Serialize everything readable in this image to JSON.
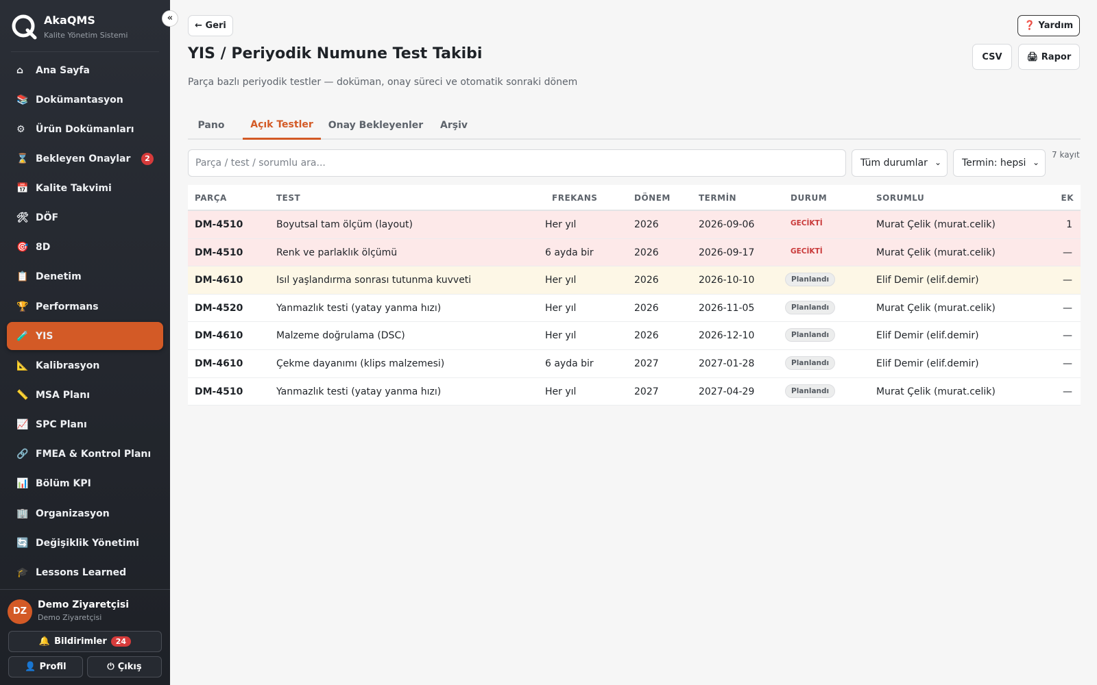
{
  "app": {
    "name": "AkaQMS",
    "subtitle": "Kalite Yönetim Sistemi",
    "collapse": "«"
  },
  "sidebar": {
    "items": [
      {
        "icon": "⌂",
        "label": "Ana Sayfa"
      },
      {
        "icon": "📚",
        "label": "Dokümantasyon"
      },
      {
        "icon": "⚙",
        "label": "Ürün Dokümanları"
      },
      {
        "icon": "⌛",
        "label": "Bekleyen Onaylar",
        "badge": "2"
      },
      {
        "icon": "📅",
        "label": "Kalite Takvimi"
      },
      {
        "icon": "🛠",
        "label": "DÖF"
      },
      {
        "icon": "🎯",
        "label": "8D"
      },
      {
        "icon": "📋",
        "label": "Denetim"
      },
      {
        "icon": "🏆",
        "label": "Performans"
      },
      {
        "icon": "🧪",
        "label": "YIS",
        "active": true
      },
      {
        "icon": "📐",
        "label": "Kalibrasyon"
      },
      {
        "icon": "📏",
        "label": "MSA Planı"
      },
      {
        "icon": "📈",
        "label": "SPC Planı"
      },
      {
        "icon": "🔗",
        "label": "FMEA & Kontrol Planı"
      },
      {
        "icon": "📊",
        "label": "Bölüm KPI"
      },
      {
        "icon": "🏢",
        "label": "Organizasyon"
      },
      {
        "icon": "🔄",
        "label": "Değişiklik Yönetimi"
      },
      {
        "icon": "🎓",
        "label": "Lessons Learned"
      }
    ]
  },
  "user": {
    "initials": "DZ",
    "name": "Demo Ziyaretçisi",
    "role": "Demo Ziyaretçisi",
    "notifications_label": "Bildirimler",
    "notifications_icon": "🔔",
    "notifications_count": "24",
    "profile_label": "Profil",
    "profile_icon": "👤",
    "logout_label": "Çıkış",
    "logout_icon": "⏻"
  },
  "header": {
    "back_label": "← Geri",
    "help_label": "❓ Yardım",
    "csv_label": "CSV",
    "report_label": "🖨 Rapor",
    "title": "YIS / Periyodik Numune Test Takibi",
    "subtitle": "Parça bazlı periyodik testler — doküman, onay süreci ve otomatik sonraki dönem"
  },
  "tabs": [
    {
      "label": "Pano"
    },
    {
      "label": "Açık Testler",
      "active": true
    },
    {
      "label": "Onay Bekleyenler"
    },
    {
      "label": "Arşiv"
    }
  ],
  "filters": {
    "search_placeholder": "Parça / test / sorumlu ara...",
    "status_value": "Tüm durumlar",
    "term_value": "Termin: hepsi",
    "count": "7 kayıt"
  },
  "table": {
    "columns": [
      "PARÇA",
      "TEST",
      "FREKANS",
      "DÖNEM",
      "TERMİN",
      "DURUM",
      "SORUMLU",
      "EK"
    ],
    "rows": [
      {
        "part": "DM-4510",
        "test": "Boyutsal tam ölçüm (layout)",
        "freq": "Her yıl",
        "period": "2026",
        "due": "2026-09-06",
        "status": "GECİKTİ",
        "owner": "Murat Çelik (murat.celik)",
        "ek": "1",
        "tone": "late"
      },
      {
        "part": "DM-4510",
        "test": "Renk ve parlaklık ölçümü",
        "freq": "6 ayda bir",
        "period": "2026",
        "due": "2026-09-17",
        "status": "GECİKTİ",
        "owner": "Murat Çelik (murat.celik)",
        "ek": "—",
        "tone": "late"
      },
      {
        "part": "DM-4610",
        "test": "Isıl yaşlandırma sonrası tutunma kuvveti",
        "freq": "Her yıl",
        "period": "2026",
        "due": "2026-10-10",
        "status": "Planlandı",
        "owner": "Elif Demir (elif.demir)",
        "ek": "—",
        "tone": "warn"
      },
      {
        "part": "DM-4520",
        "test": "Yanmazlık testi (yatay yanma hızı)",
        "freq": "Her yıl",
        "period": "2026",
        "due": "2026-11-05",
        "status": "Planlandı",
        "owner": "Murat Çelik (murat.celik)",
        "ek": "—",
        "tone": "normal"
      },
      {
        "part": "DM-4610",
        "test": "Malzeme doğrulama (DSC)",
        "freq": "Her yıl",
        "period": "2026",
        "due": "2026-12-10",
        "status": "Planlandı",
        "owner": "Elif Demir (elif.demir)",
        "ek": "—",
        "tone": "normal"
      },
      {
        "part": "DM-4610",
        "test": "Çekme dayanımı (klips malzemesi)",
        "freq": "6 ayda bir",
        "period": "2027",
        "due": "2027-01-28",
        "status": "Planlandı",
        "owner": "Elif Demir (elif.demir)",
        "ek": "—",
        "tone": "normal"
      },
      {
        "part": "DM-4510",
        "test": "Yanmazlık testi (yatay yanma hızı)",
        "freq": "Her yıl",
        "period": "2027",
        "due": "2027-04-29",
        "status": "Planlandı",
        "owner": "Murat Çelik (murat.celik)",
        "ek": "—",
        "tone": "normal"
      }
    ]
  },
  "colors": {
    "accent": "#d35a26",
    "late_bg": "#fde9e9",
    "warn_bg": "#fdf7e6",
    "sidebar_bg": "#24272e"
  }
}
